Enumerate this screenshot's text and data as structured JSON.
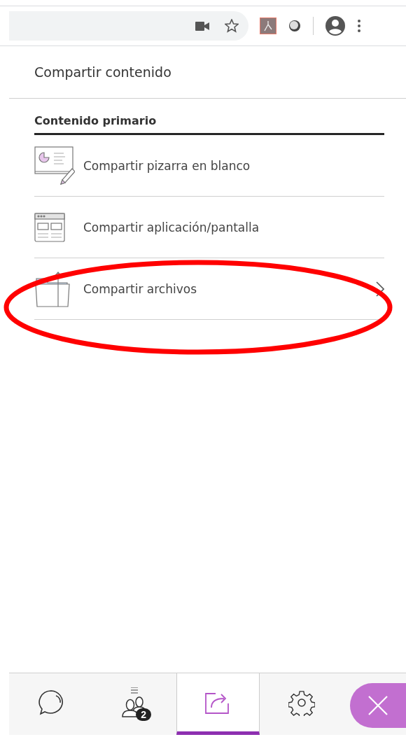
{
  "panel": {
    "title": "Compartir contenido",
    "section": "Contenido primario"
  },
  "items": [
    {
      "kind": "whiteboard",
      "label": "Compartir pizarra en blanco",
      "has_arrow": false
    },
    {
      "kind": "screen",
      "label": "Compartir aplicación/pantalla",
      "has_arrow": false
    },
    {
      "kind": "files",
      "label": "Compartir archivos",
      "has_arrow": true
    }
  ],
  "tabs": [
    {
      "kind": "chat",
      "selected": false
    },
    {
      "kind": "people",
      "selected": false,
      "badge": "2"
    },
    {
      "kind": "share",
      "selected": true
    },
    {
      "kind": "settings",
      "selected": false
    }
  ]
}
